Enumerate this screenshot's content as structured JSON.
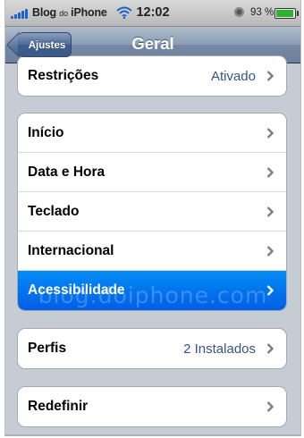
{
  "status_bar": {
    "carrier": "Blog",
    "carrier_small": "do",
    "carrier_suffix": "iPhone",
    "time": "12:02",
    "battery_percent": "93 %",
    "battery_level": 0.93,
    "signal_icon": "signal-bars-icon",
    "wifi_icon": "wifi-icon",
    "lock_icon": "rotation-lock-icon"
  },
  "nav": {
    "back_label": "Ajustes",
    "title": "Geral"
  },
  "groups": [
    {
      "rows": [
        {
          "label": "Restrições",
          "value": "Ativado"
        }
      ]
    },
    {
      "rows": [
        {
          "label": "Início",
          "value": ""
        },
        {
          "label": "Data e Hora",
          "value": ""
        },
        {
          "label": "Teclado",
          "value": ""
        },
        {
          "label": "Internacional",
          "value": ""
        },
        {
          "label": "Acessibilidade",
          "value": "",
          "selected": true
        }
      ]
    },
    {
      "rows": [
        {
          "label": "Perfis",
          "value": "2 Instalados"
        }
      ]
    },
    {
      "rows": [
        {
          "label": "Redefinir",
          "value": ""
        }
      ]
    }
  ],
  "watermark": "blog.doiphone.com",
  "colors": {
    "selection": "#0a6fee",
    "value_text": "#385487",
    "background": "#c5ccd4"
  }
}
